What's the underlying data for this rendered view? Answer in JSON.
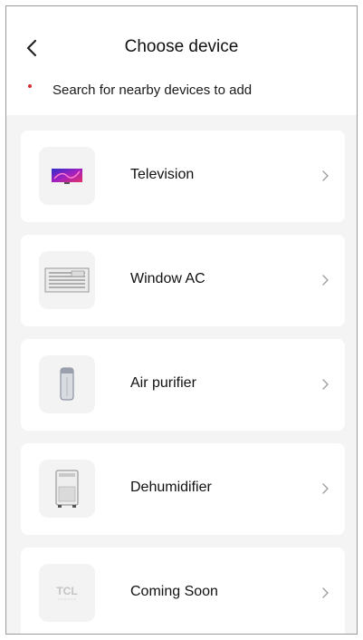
{
  "header": {
    "title": "Choose device",
    "hint": "Search for nearby devices to add"
  },
  "devices": [
    {
      "label": "Television",
      "icon": "television-icon"
    },
    {
      "label": "Window AC",
      "icon": "window-ac-icon"
    },
    {
      "label": "Air purifier",
      "icon": "air-purifier-icon"
    },
    {
      "label": "Dehumidifier",
      "icon": "dehumidifier-icon"
    },
    {
      "label": "Coming Soon",
      "icon": "tcl-logo-icon",
      "logo_text": "TCL"
    }
  ],
  "colors": {
    "background": "#f4f4f4",
    "card": "#ffffff",
    "hint_dot": "#d32f2f"
  }
}
